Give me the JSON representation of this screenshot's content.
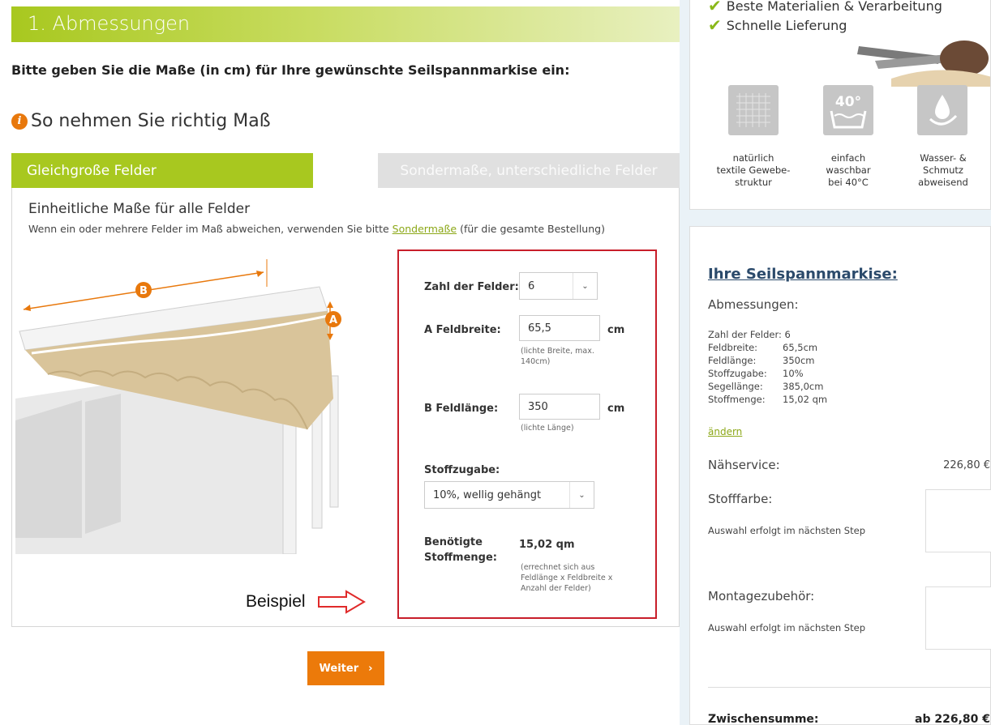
{
  "section": {
    "title": "1. Abmessungen"
  },
  "instruction": "Bitte geben Sie die Maße (in cm) für Ihre gewünschte Seilspannmarkise ein:",
  "howto": {
    "icon": "info-icon",
    "label": "So nehmen Sie richtig Maß"
  },
  "tabs": [
    {
      "label": "Gleichgroße Felder",
      "active": true
    },
    {
      "label": "Sondermaße, unterschiedliche Felder",
      "active": false
    }
  ],
  "panel": {
    "title": "Einheitliche Maße für alle Felder",
    "subtitle_pre": "Wenn ein oder mehrere Felder im Maß abweichen, verwenden Sie bitte ",
    "subtitle_link": "Sondermaße",
    "subtitle_post": " (für die gesamte Bestellung)",
    "diagram_label_b": "B",
    "diagram_label_a": "A",
    "beispiel": "Beispiel"
  },
  "form": {
    "felder_label": "Zahl der Felder:",
    "felder_value": "6",
    "breite_label": "A Feldbreite:",
    "breite_value": "65,5",
    "breite_unit": "cm",
    "breite_hint_1": "(lichte Breite, max.",
    "breite_hint_2": "140cm)",
    "laenge_label": "B Feldlänge:",
    "laenge_value": "350",
    "laenge_unit": "cm",
    "laenge_hint": "(lichte Länge)",
    "zugabe_label": "Stoffzugabe:",
    "zugabe_value": "10%, wellig gehängt",
    "menge_label_1": "Benötigte",
    "menge_label_2": "Stoffmenge:",
    "menge_value": "15,02 qm",
    "menge_hint_1": "(errechnet sich aus",
    "menge_hint_2": "Feldlänge x Feldbreite x",
    "menge_hint_3": "Anzahl der Felder)"
  },
  "weiter": {
    "label": "Weiter",
    "icon": "chevron-right-icon"
  },
  "features": {
    "checks": [
      "Beste Materialien & Verarbeitung",
      "Schnelle Lieferung"
    ],
    "icons": [
      {
        "icon": "fabric-texture-icon",
        "line1": "natürlich",
        "line2": "textile Gewebe-",
        "line3": "struktur"
      },
      {
        "icon": "wash-40-icon",
        "badge": "40°",
        "line1": "einfach",
        "line2": "waschbar",
        "line3": "bei 40°C"
      },
      {
        "icon": "water-repellent-icon",
        "line1": "Wasser- &",
        "line2": "Schmutz",
        "line3": "abweisend"
      }
    ]
  },
  "summary": {
    "title": "Ihre Seilspannmarkise:",
    "dims_heading": "Abmessungen:",
    "rows": [
      {
        "k": "Zahl der Felder: 6",
        "v": ""
      },
      {
        "k": "Feldbreite:",
        "v": "65,5cm"
      },
      {
        "k": "Feldlänge:",
        "v": "350cm"
      },
      {
        "k": "Stoffzugabe:",
        "v": "10%"
      },
      {
        "k": "Segellänge:",
        "v": "385,0cm"
      },
      {
        "k": "Stoffmenge:",
        "v": "15,02 qm"
      }
    ],
    "change_link": "ändern",
    "naehservice_label": "Nähservice:",
    "naehservice_price": "226,80 €",
    "stofffarbe_label": "Stofffarbe:",
    "stofffarbe_note": "Auswahl erfolgt im nächsten Step",
    "montage_label": "Montagezubehör:",
    "montage_note": "Auswahl erfolgt im nächsten Step",
    "subtotal_label": "Zwischensumme:",
    "subtotal_value": "ab 226,80 €"
  },
  "colors": {
    "green": "#a8c81f",
    "orange": "#ec7a0a",
    "red_frame": "#c81e2a",
    "navy": "#2b4a6b"
  }
}
